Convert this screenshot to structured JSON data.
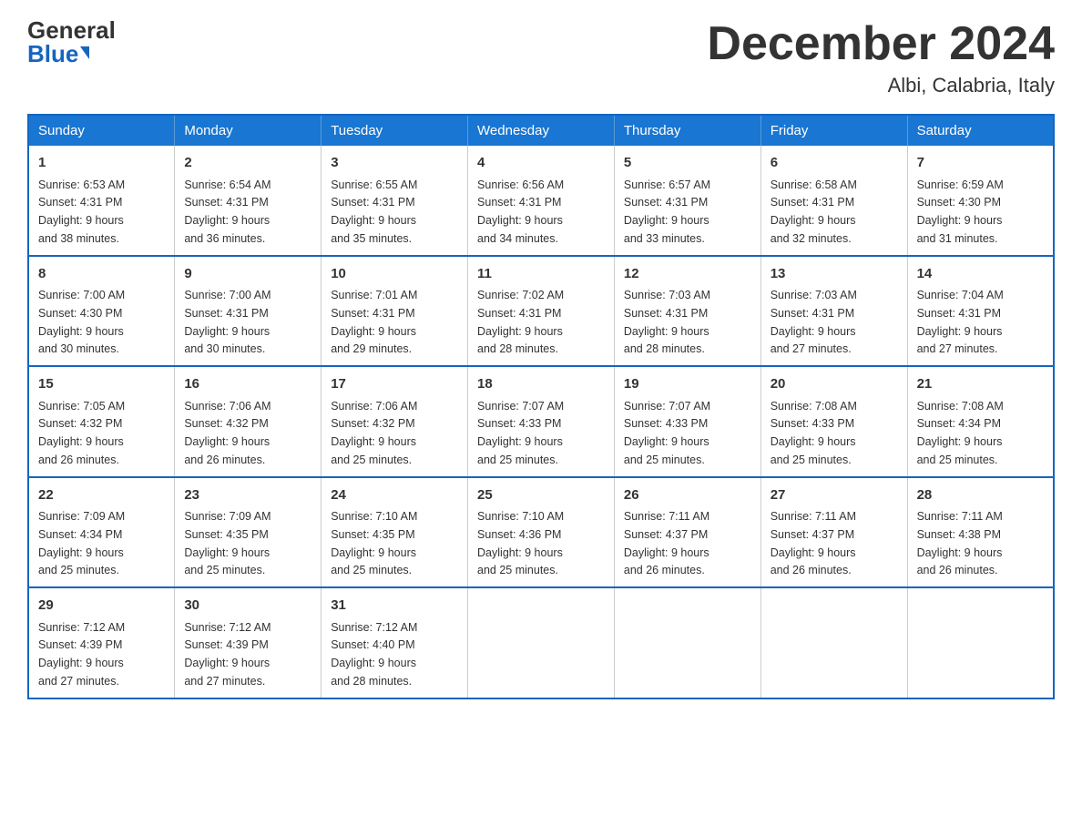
{
  "logo": {
    "general": "General",
    "blue": "Blue"
  },
  "title": "December 2024",
  "subtitle": "Albi, Calabria, Italy",
  "weekdays": [
    "Sunday",
    "Monday",
    "Tuesday",
    "Wednesday",
    "Thursday",
    "Friday",
    "Saturday"
  ],
  "weeks": [
    [
      {
        "day": "1",
        "sunrise": "6:53 AM",
        "sunset": "4:31 PM",
        "daylight": "9 hours and 38 minutes."
      },
      {
        "day": "2",
        "sunrise": "6:54 AM",
        "sunset": "4:31 PM",
        "daylight": "9 hours and 36 minutes."
      },
      {
        "day": "3",
        "sunrise": "6:55 AM",
        "sunset": "4:31 PM",
        "daylight": "9 hours and 35 minutes."
      },
      {
        "day": "4",
        "sunrise": "6:56 AM",
        "sunset": "4:31 PM",
        "daylight": "9 hours and 34 minutes."
      },
      {
        "day": "5",
        "sunrise": "6:57 AM",
        "sunset": "4:31 PM",
        "daylight": "9 hours and 33 minutes."
      },
      {
        "day": "6",
        "sunrise": "6:58 AM",
        "sunset": "4:31 PM",
        "daylight": "9 hours and 32 minutes."
      },
      {
        "day": "7",
        "sunrise": "6:59 AM",
        "sunset": "4:30 PM",
        "daylight": "9 hours and 31 minutes."
      }
    ],
    [
      {
        "day": "8",
        "sunrise": "7:00 AM",
        "sunset": "4:30 PM",
        "daylight": "9 hours and 30 minutes."
      },
      {
        "day": "9",
        "sunrise": "7:00 AM",
        "sunset": "4:31 PM",
        "daylight": "9 hours and 30 minutes."
      },
      {
        "day": "10",
        "sunrise": "7:01 AM",
        "sunset": "4:31 PM",
        "daylight": "9 hours and 29 minutes."
      },
      {
        "day": "11",
        "sunrise": "7:02 AM",
        "sunset": "4:31 PM",
        "daylight": "9 hours and 28 minutes."
      },
      {
        "day": "12",
        "sunrise": "7:03 AM",
        "sunset": "4:31 PM",
        "daylight": "9 hours and 28 minutes."
      },
      {
        "day": "13",
        "sunrise": "7:03 AM",
        "sunset": "4:31 PM",
        "daylight": "9 hours and 27 minutes."
      },
      {
        "day": "14",
        "sunrise": "7:04 AM",
        "sunset": "4:31 PM",
        "daylight": "9 hours and 27 minutes."
      }
    ],
    [
      {
        "day": "15",
        "sunrise": "7:05 AM",
        "sunset": "4:32 PM",
        "daylight": "9 hours and 26 minutes."
      },
      {
        "day": "16",
        "sunrise": "7:06 AM",
        "sunset": "4:32 PM",
        "daylight": "9 hours and 26 minutes."
      },
      {
        "day": "17",
        "sunrise": "7:06 AM",
        "sunset": "4:32 PM",
        "daylight": "9 hours and 25 minutes."
      },
      {
        "day": "18",
        "sunrise": "7:07 AM",
        "sunset": "4:33 PM",
        "daylight": "9 hours and 25 minutes."
      },
      {
        "day": "19",
        "sunrise": "7:07 AM",
        "sunset": "4:33 PM",
        "daylight": "9 hours and 25 minutes."
      },
      {
        "day": "20",
        "sunrise": "7:08 AM",
        "sunset": "4:33 PM",
        "daylight": "9 hours and 25 minutes."
      },
      {
        "day": "21",
        "sunrise": "7:08 AM",
        "sunset": "4:34 PM",
        "daylight": "9 hours and 25 minutes."
      }
    ],
    [
      {
        "day": "22",
        "sunrise": "7:09 AM",
        "sunset": "4:34 PM",
        "daylight": "9 hours and 25 minutes."
      },
      {
        "day": "23",
        "sunrise": "7:09 AM",
        "sunset": "4:35 PM",
        "daylight": "9 hours and 25 minutes."
      },
      {
        "day": "24",
        "sunrise": "7:10 AM",
        "sunset": "4:35 PM",
        "daylight": "9 hours and 25 minutes."
      },
      {
        "day": "25",
        "sunrise": "7:10 AM",
        "sunset": "4:36 PM",
        "daylight": "9 hours and 25 minutes."
      },
      {
        "day": "26",
        "sunrise": "7:11 AM",
        "sunset": "4:37 PM",
        "daylight": "9 hours and 26 minutes."
      },
      {
        "day": "27",
        "sunrise": "7:11 AM",
        "sunset": "4:37 PM",
        "daylight": "9 hours and 26 minutes."
      },
      {
        "day": "28",
        "sunrise": "7:11 AM",
        "sunset": "4:38 PM",
        "daylight": "9 hours and 26 minutes."
      }
    ],
    [
      {
        "day": "29",
        "sunrise": "7:12 AM",
        "sunset": "4:39 PM",
        "daylight": "9 hours and 27 minutes."
      },
      {
        "day": "30",
        "sunrise": "7:12 AM",
        "sunset": "4:39 PM",
        "daylight": "9 hours and 27 minutes."
      },
      {
        "day": "31",
        "sunrise": "7:12 AM",
        "sunset": "4:40 PM",
        "daylight": "9 hours and 28 minutes."
      },
      null,
      null,
      null,
      null
    ]
  ],
  "labels": {
    "sunrise": "Sunrise:",
    "sunset": "Sunset:",
    "daylight": "Daylight:"
  }
}
